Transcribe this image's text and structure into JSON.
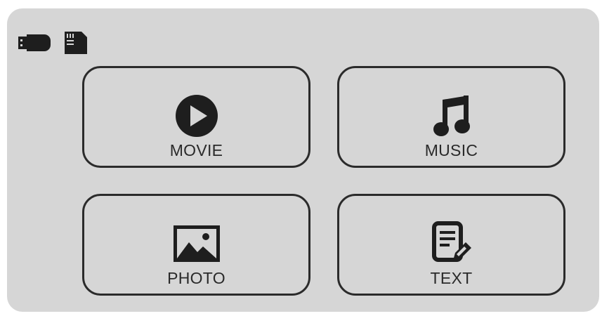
{
  "status": {
    "icons": [
      "usb-drive-icon",
      "sd-card-icon"
    ]
  },
  "menu": {
    "tiles": [
      {
        "id": "movie",
        "label": "MOVIE",
        "icon": "play-circle-icon"
      },
      {
        "id": "music",
        "label": "MUSIC",
        "icon": "music-note-icon"
      },
      {
        "id": "photo",
        "label": "PHOTO",
        "icon": "image-icon"
      },
      {
        "id": "text",
        "label": "TEXT",
        "icon": "text-document-icon"
      }
    ]
  },
  "colors": {
    "background": "#d6d6d6",
    "foreground": "#1e1e1e"
  }
}
